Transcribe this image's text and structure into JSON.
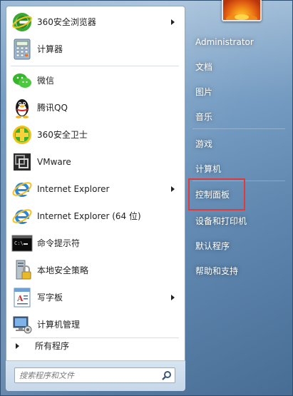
{
  "pinned": [
    {
      "label": "360安全浏览器",
      "icon": "360-browser-icon",
      "has_submenu": true
    },
    {
      "label": "计算器",
      "icon": "calculator-icon",
      "has_submenu": false
    }
  ],
  "recent": [
    {
      "label": "微信",
      "icon": "wechat-icon",
      "has_submenu": false
    },
    {
      "label": "腾讯QQ",
      "icon": "qq-penguin-icon",
      "has_submenu": false
    },
    {
      "label": "360安全卫士",
      "icon": "360-safeguard-icon",
      "has_submenu": false
    },
    {
      "label": "VMware",
      "icon": "vmware-icon",
      "has_submenu": false
    },
    {
      "label": "Internet Explorer",
      "icon": "ie-icon",
      "has_submenu": true
    },
    {
      "label": "Internet Explorer (64 位)",
      "icon": "ie-icon",
      "has_submenu": false
    },
    {
      "label": "命令提示符",
      "icon": "cmd-icon",
      "has_submenu": false
    },
    {
      "label": "本地安全策略",
      "icon": "security-policy-icon",
      "has_submenu": false
    },
    {
      "label": "写字板",
      "icon": "wordpad-icon",
      "has_submenu": true
    },
    {
      "label": "计算机管理",
      "icon": "computer-management-icon",
      "has_submenu": false
    }
  ],
  "all_programs_label": "所有程序",
  "search": {
    "placeholder": "搜索程序和文件"
  },
  "right": {
    "user": "Administrator",
    "items": [
      "文档",
      "图片",
      "音乐",
      "游戏",
      "计算机",
      "控制面板",
      "设备和打印机",
      "默认程序",
      "帮助和支持"
    ],
    "highlighted": "控制面板"
  },
  "colors": {
    "highlight_border": "#e23a3a",
    "frame": "#5c86b0"
  }
}
